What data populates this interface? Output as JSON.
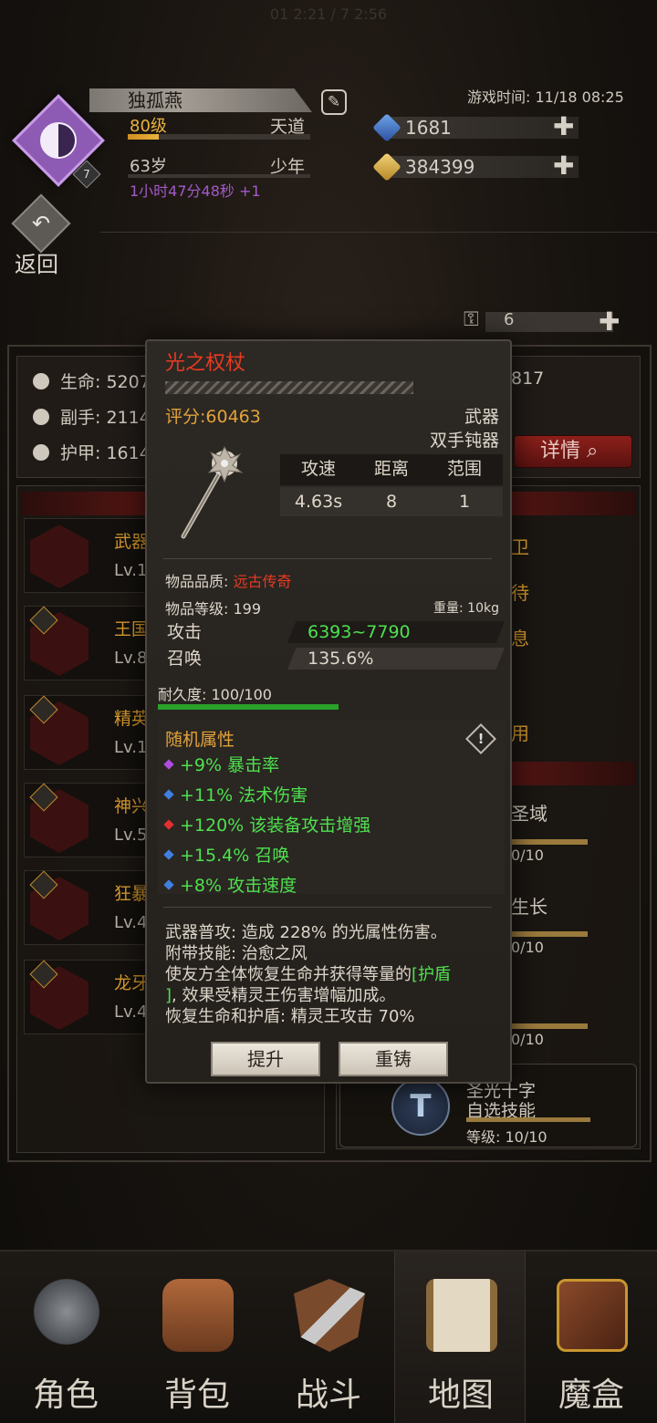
{
  "status_bar": {
    "time": "01 2:21 / 7 2:56"
  },
  "player": {
    "name": "独孤燕",
    "avatar_level": "7",
    "level": "80级",
    "realm": "天道",
    "xp_fraction": 0.17,
    "age": "63岁",
    "stage": "少年",
    "timer": "1小时47分48秒 +1"
  },
  "game_time": "游戏时间: 11/18 08:25",
  "currency": {
    "gems": "1681",
    "gold": "384399",
    "keys": "6"
  },
  "back": {
    "label": "返回"
  },
  "stats": {
    "hp": "生命: 5207",
    "offhand": "副手: 2114",
    "armor": "护甲: 1614",
    "right_value": "817",
    "detail_button": "详情"
  },
  "equipment": [
    {
      "name": "武器",
      "lv": "Lv.1"
    },
    {
      "name": "王国",
      "lv": "Lv.8"
    },
    {
      "name": "精英",
      "lv": "Lv.1"
    },
    {
      "name": "神兴",
      "lv": "Lv.5"
    },
    {
      "name": "狂暴",
      "lv": "Lv.4"
    },
    {
      "name": "龙牙",
      "lv": "Lv.4"
    }
  ],
  "right_panel": {
    "gold_items": [
      "卫",
      "待",
      "息",
      "用"
    ],
    "skills": [
      {
        "name": "圣域",
        "lv": "0/10"
      },
      {
        "name": "生长",
        "lv": "0/10"
      },
      {
        "name": "",
        "lv": "0/10"
      }
    ],
    "card": {
      "line1": "圣光十字",
      "line2": "自选技能",
      "lv": "等级: 10/10"
    }
  },
  "item": {
    "name": "光之权杖",
    "score": "评分:60463",
    "type": "武器",
    "subtype": "双手钝器",
    "table_headers": [
      "攻速",
      "距离",
      "范围"
    ],
    "table_values": [
      "4.63s",
      "8",
      "1"
    ],
    "quality_label": "物品品质: ",
    "quality_value": "远古传奇",
    "item_level": "物品等级: 199",
    "weight": "重量: 10kg",
    "attack_label": "攻击",
    "attack_value": "6393~7790",
    "summon_label": "召唤",
    "summon_value": "135.6%",
    "durability": "耐久度: 100/100",
    "durability_fraction": 1.0,
    "random_title": "随机属性",
    "affixes": [
      {
        "text": "+9% 暴击率",
        "color": "#b04ce0"
      },
      {
        "text": "+11% 法术伤害",
        "color": "#3f7fe0"
      },
      {
        "text": "+120% 该装备攻击增强",
        "color": "#e03030"
      },
      {
        "text": "+15.4% 召唤",
        "color": "#3f7fe0"
      },
      {
        "text": "+8% 攻击速度",
        "color": "#3f7fe0"
      }
    ],
    "desc_line1": "武器普攻: 造成 228% 的光属性伤害。",
    "desc_line2": "附带技能: 治愈之风",
    "desc_line3a": "使友方全体恢复生命并获得等量的",
    "desc_line3b": "[护盾",
    "desc_line4a": "]",
    "desc_line4b": ", 效果受精灵王伤害增幅加成。",
    "desc_line5": "恢复生命和护盾: 精灵王攻击 70%",
    "upgrade_button": "提升",
    "reforge_button": "重铸"
  },
  "nav": [
    {
      "label": "角色",
      "icon": "helmet-icon"
    },
    {
      "label": "背包",
      "icon": "backpack-icon"
    },
    {
      "label": "战斗",
      "icon": "sword-shield-icon"
    },
    {
      "label": "地图",
      "icon": "scroll-map-icon"
    },
    {
      "label": "魔盒",
      "icon": "magic-box-icon"
    }
  ],
  "nav_active": "地图"
}
